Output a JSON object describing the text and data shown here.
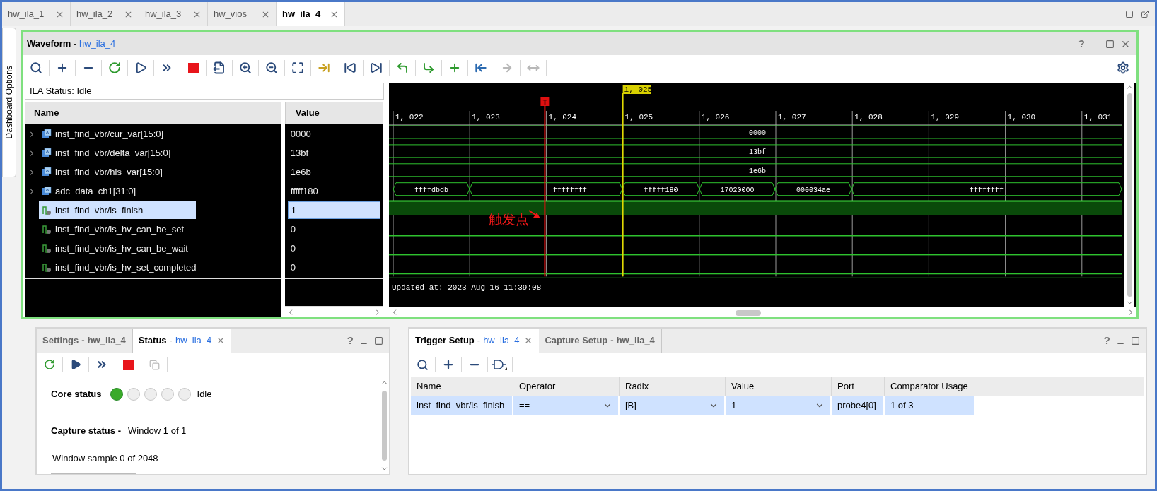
{
  "editor_tabs": [
    {
      "label": "hw_ila_1",
      "selected": false
    },
    {
      "label": "hw_ila_2",
      "selected": false
    },
    {
      "label": "hw_ila_3",
      "selected": false
    },
    {
      "label": "hw_vios",
      "selected": false
    },
    {
      "label": "hw_ila_4",
      "selected": true
    }
  ],
  "side_tab": "Dashboard Options",
  "waveform": {
    "title": "Waveform",
    "separator": "-",
    "source": "hw_ila_4",
    "help": "?",
    "ila_status": "ILA Status:  Idle",
    "columns": [
      "Name",
      "Value"
    ],
    "signals": [
      {
        "name": "inst_find_vbr/cur_var[15:0]",
        "value": "0000",
        "kind": "bus",
        "expandable": true,
        "selected": false,
        "segments": [
          "0000"
        ]
      },
      {
        "name": "inst_find_vbr/delta_var[15:0]",
        "value": "13bf",
        "kind": "bus",
        "expandable": true,
        "selected": false,
        "segments": [
          "13bf"
        ]
      },
      {
        "name": "inst_find_vbr/his_var[15:0]",
        "value": "1e6b",
        "kind": "bus",
        "expandable": true,
        "selected": false,
        "segments": [
          "1e6b"
        ]
      },
      {
        "name": "adc_data_ch1[31:0]",
        "value": "fffff180",
        "kind": "bus",
        "expandable": true,
        "selected": false,
        "segments": [
          "ffffdbdb",
          "ffffffff",
          "fffff180",
          "17020000",
          "000034ae",
          "ffffffff"
        ]
      },
      {
        "name": "inst_find_vbr/is_finish",
        "value": "1",
        "kind": "bit",
        "selected": true,
        "high": true
      },
      {
        "name": "inst_find_vbr/is_hv_can_be_set",
        "value": "0",
        "kind": "bit",
        "selected": false,
        "high": false
      },
      {
        "name": "inst_find_vbr/is_hv_can_be_wait",
        "value": "0",
        "kind": "bit",
        "selected": false,
        "high": false
      },
      {
        "name": "inst_find_vbr/is_hv_set_completed",
        "value": "0",
        "kind": "bit",
        "selected": false,
        "high": false
      }
    ],
    "time_ticks": [
      "1, 022",
      "1, 023",
      "1, 024",
      "1, 025",
      "1, 026",
      "1, 027",
      "1, 028",
      "1, 029",
      "1, 030",
      "1, 031"
    ],
    "cursor_label": "1, 025",
    "trigger_marker": "T",
    "annotation": "触发点",
    "updated": "Updated at: 2023-Aug-16 11:39:08"
  },
  "status_panel": {
    "help": "?",
    "tabs": [
      {
        "label": "Settings",
        "separator": "-",
        "source": "hw_ila_4",
        "selected": false
      },
      {
        "label": "Status",
        "separator": "-",
        "source": "hw_ila_4",
        "selected": true
      }
    ],
    "core_status": {
      "label": "Core status",
      "lights": [
        {
          "on": true
        },
        {
          "on": false
        },
        {
          "on": false
        },
        {
          "on": false
        },
        {
          "on": false
        }
      ],
      "state": "Idle"
    },
    "capture_status": {
      "label": "Capture status -",
      "value": "Window 1 of 1"
    },
    "window_sample": "Window sample 0 of 2048"
  },
  "trigger_panel": {
    "help": "?",
    "tabs": [
      {
        "label": "Trigger Setup",
        "separator": "-",
        "source": "hw_ila_4",
        "selected": true
      },
      {
        "label": "Capture Setup",
        "separator": "-",
        "source": "hw_ila_4",
        "selected": false
      }
    ],
    "columns": [
      "Name",
      "Operator",
      "Radix",
      "Value",
      "Port",
      "Comparator Usage"
    ],
    "rows": [
      {
        "selected": true,
        "cells": [
          "inst_find_vbr/is_finish",
          "==",
          "[B]",
          "1",
          "probe4[0]",
          "1 of 3"
        ]
      }
    ]
  }
}
